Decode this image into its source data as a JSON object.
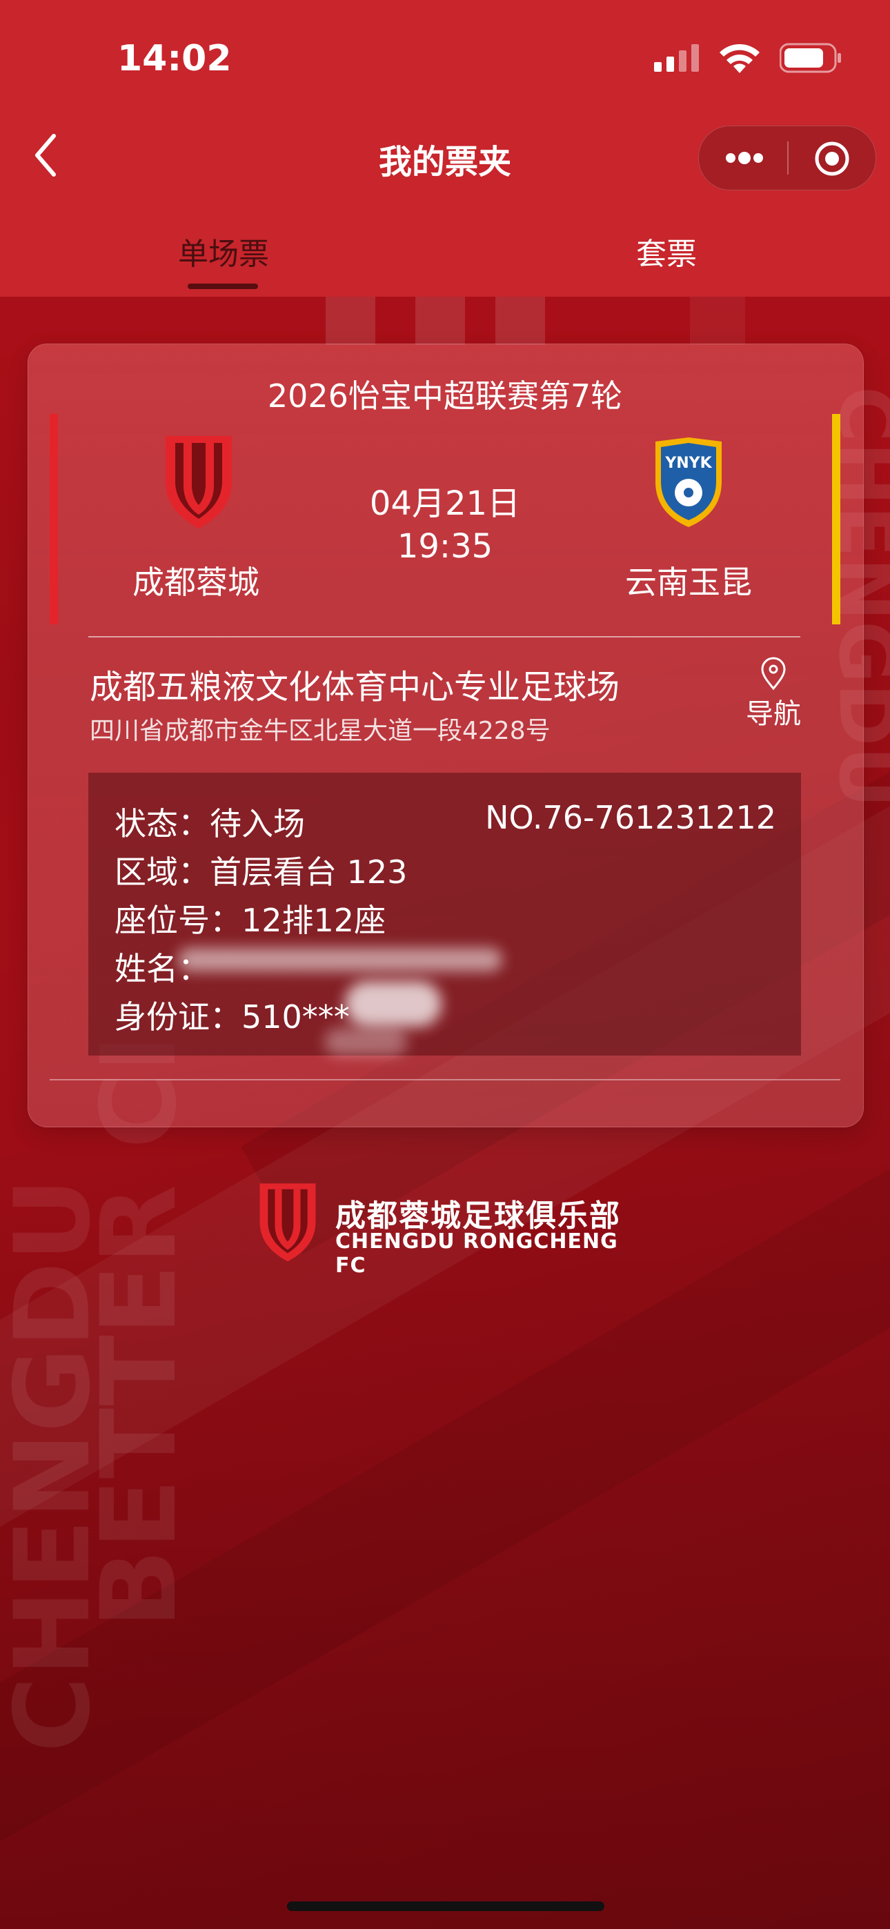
{
  "status_bar": {
    "time": "14:02"
  },
  "nav": {
    "title": "我的票夹"
  },
  "tabs": [
    {
      "label": "单场票",
      "active": true
    },
    {
      "label": "套票",
      "active": false
    }
  ],
  "ticket": {
    "round": "2026怡宝中超联赛第7轮",
    "date": "04月21日",
    "time": "19:35",
    "home_team": "成都蓉城",
    "away_team": "云南玉昆",
    "away_crest_text": "YNYK",
    "venue": "成都五粮液文化体育中心专业足球场",
    "address": "四川省成都市金牛区北星大道一段4228号",
    "nav_label": "导航",
    "ticket_no": "NO.76-761231212",
    "status_label": "状态：",
    "status_value": "待入场",
    "area_label": "区域：",
    "area_value": "首层看台 123",
    "seat_label": "座位号：",
    "seat_value": "12排12座",
    "name_label": "姓名：",
    "id_label": "身份证：",
    "id_value": "510***"
  },
  "club": {
    "name_cn": "成都蓉城足球俱乐部",
    "name_en": "CHENGDU RONGCHENG FC"
  },
  "background_text": {
    "left_1": "CHENGDU",
    "left_2": "BETTER CI",
    "right": "CHENGDU"
  },
  "colors": {
    "nav_red": "#c8252c",
    "home_bar": "#e4242b",
    "away_bar": "#f5c400"
  }
}
